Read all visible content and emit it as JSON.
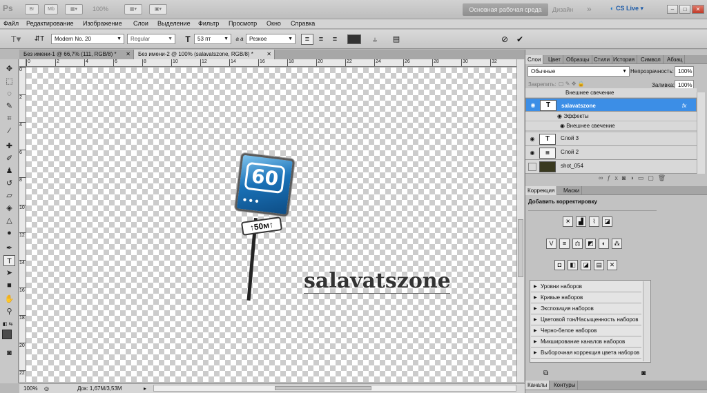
{
  "app": {
    "logo": "Ps",
    "bridge": "Br",
    "minibridge": "Mb",
    "zoom": "100%",
    "workspace_active": "Основная рабочая среда",
    "workspace_design": "Дизайн",
    "more": "»",
    "cs_live": "CS Live",
    "win_min": "–",
    "win_max": "□",
    "win_close": "✕"
  },
  "menu": [
    "Файл",
    "Редактирование",
    "Изображение",
    "Слои",
    "Выделение",
    "Фильтр",
    "Просмотр",
    "Окно",
    "Справка"
  ],
  "options": {
    "font_family": "Modern No. 20",
    "font_style": "Regular",
    "font_size": "53 пт",
    "aa_label": "a a",
    "antialias": "Резкое",
    "cancel": "⊘",
    "commit": "✔"
  },
  "tabs": [
    {
      "label": "Без имени-1 @ 66,7% (111, RGB/8) *",
      "close": "✕"
    },
    {
      "label": "Без имени-2 @ 100% (salavatszone, RGB/8) *",
      "close": "✕"
    }
  ],
  "ruler_top": [
    "0",
    "2",
    "4",
    "6",
    "8",
    "10",
    "12",
    "14",
    "16",
    "18",
    "20",
    "22",
    "24",
    "26",
    "28",
    "30",
    "32",
    "34"
  ],
  "ruler_left": [
    "0",
    "2",
    "4",
    "6",
    "8",
    "10",
    "12",
    "14",
    "16",
    "18",
    "20",
    "22"
  ],
  "canvas": {
    "sign_number": "60",
    "sign_plate": "↑50м↑",
    "text_layer": "salavatszone"
  },
  "status": {
    "zoom": "100%",
    "doc": "Док: 1,67M/3,53M"
  },
  "layers_panel": {
    "tabs": [
      "Слои",
      "Цвет",
      "Образцы",
      "Стили",
      "История",
      "Символ",
      "Абзац"
    ],
    "blend_mode": "Обычные",
    "opacity_label": "Непрозрачность:",
    "opacity": "100%",
    "lock_label": "Закрепить:",
    "fill_label": "Заливка:",
    "fill": "100%",
    "prev_effect": "Внешнее свечение",
    "layers": [
      {
        "name": "salavatszone",
        "thumb": "T",
        "selected": true,
        "fx": "fx"
      },
      {
        "name": "Слой 3",
        "thumb": "T",
        "selected": false
      },
      {
        "name": "Слой 2",
        "thumb": "",
        "selected": false
      },
      {
        "name": "shot_054",
        "thumb": "",
        "selected": false
      }
    ],
    "effects_label": "Эффекты",
    "effect_item": "Внешнее свечение"
  },
  "adjust_panel": {
    "tabs": [
      "Коррекция",
      "Маски"
    ],
    "title": "Добавить корректировку",
    "presets": [
      "Уровни наборов",
      "Кривые наборов",
      "Экспозиция наборов",
      "Цветовой тон/Насыщенность наборов",
      "Черно-белое наборов",
      "Микширование каналов наборов",
      "Выборочная коррекция цвета наборов"
    ]
  },
  "bottom_tabs": [
    "Каналы",
    "Контуры"
  ],
  "colors": {
    "selection": "#3c8ee6",
    "sign_blue": "#1a72b8"
  }
}
